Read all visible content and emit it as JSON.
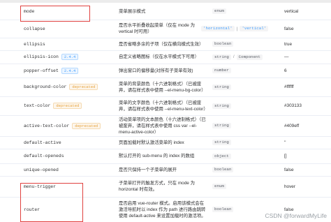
{
  "table": {
    "rows": [
      {
        "name": "mode",
        "desc": "菜单展示模式",
        "types": [
          "enum"
        ],
        "default": "vertical"
      },
      {
        "name": "collapse",
        "desc": "是否水平折叠收起菜单（仅在 mode 为 vertical 时可用）",
        "types": [
          "'horizontal'",
          "'vertical'"
        ],
        "default": "false"
      },
      {
        "name": "ellipsis",
        "desc": "是否省略多余的子项（仅在横向模式生效）",
        "types": [
          "boolean"
        ],
        "default": "true"
      },
      {
        "name": "ellipsis-icon",
        "tag": "2.4.4",
        "tag_kind": "ver",
        "desc": "自定义省略图标（仅在水平模式下可用）",
        "types": [
          "string",
          "Component"
        ],
        "default": "—"
      },
      {
        "name": "popper-offset",
        "tag": "2.4.4",
        "tag_kind": "ver",
        "desc": "弹出窗口的偏移量(对所有子菜单有效)",
        "types": [
          "number"
        ],
        "default": "6"
      },
      {
        "name": "background-color",
        "tag": "deprecated",
        "tag_kind": "dep",
        "desc": "菜单的背景颜色（十六进制格式）（已被废弃，请在样式表中使用 --el-menu-bg-color）",
        "types": [
          "string"
        ],
        "default": "#ffffff"
      },
      {
        "name": "text-color",
        "tag": "deprecated",
        "tag_kind": "dep",
        "desc": "菜单的文字颜色（十六进制格式）（已被废弃，请在样式表中使用 --el-menu-text-color）",
        "types": [
          "string"
        ],
        "default": "#303133"
      },
      {
        "name": "active-text-color",
        "tag": "deprecated",
        "tag_kind": "dep",
        "desc": "活动菜单项的文本颜色（十六进制格式）（已被废弃，请在样式表中使用 css var --el-menu-active-color）",
        "types": [
          "string"
        ],
        "default": "#409eff"
      },
      {
        "name": "default-active",
        "desc": "页面加载时默认激活菜单的 index",
        "types": [
          "string"
        ],
        "default": "''"
      },
      {
        "name": "default-openeds",
        "desc": "默认打开的 sub-menu 的 index 的数组",
        "types": [
          "object"
        ],
        "default": "[]"
      },
      {
        "name": "unique-opened",
        "desc": "是否只保持一个子菜单的展开",
        "types": [
          "boolean"
        ],
        "default": "false"
      },
      {
        "name": "menu-trigger",
        "desc": "子菜单打开的触发方式，只在 mode 为 horizontal 时有效。",
        "types": [
          "enum"
        ],
        "default": "hover"
      },
      {
        "name": "router",
        "desc": "是否启用 vue-router 模式。启用该模式会在激活导航时以 index 作为 path 进行路由跳转 使用 default-active 来设置加载时的激活项。",
        "types": [
          "boolean"
        ],
        "default": "false"
      }
    ]
  },
  "watermark": "CSDN @forwardMyLife"
}
